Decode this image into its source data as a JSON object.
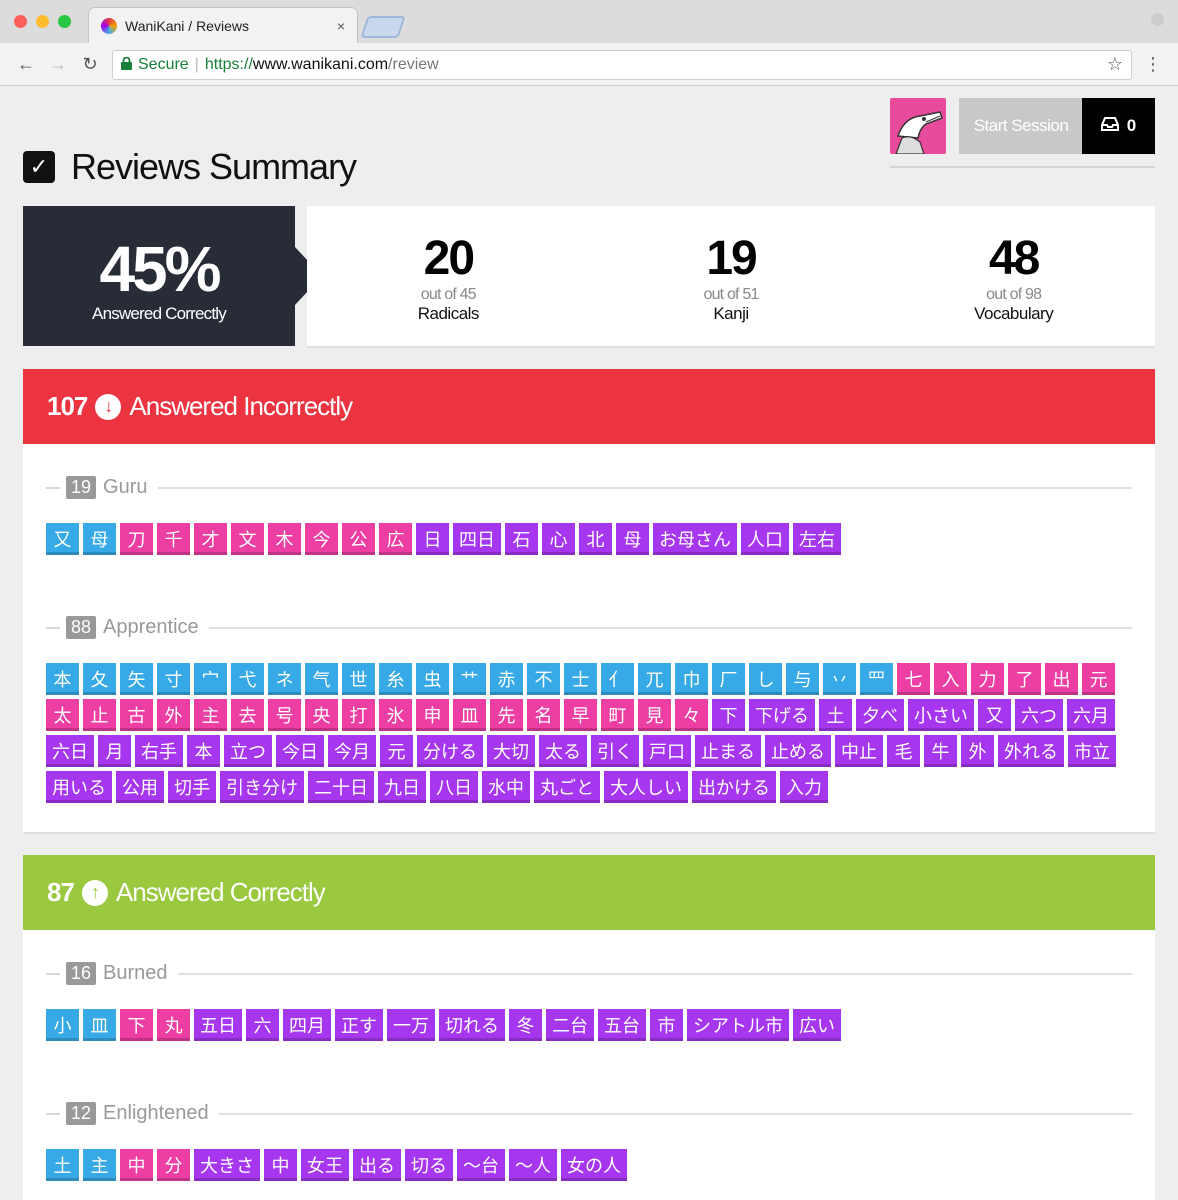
{
  "browser": {
    "tab_title": "WaniKani / Reviews",
    "tab_close": "×",
    "secure_label": "Secure",
    "url_proto": "https://",
    "url_host": "www.wanikani.com",
    "url_path": "/review"
  },
  "header": {
    "start_session_label": "Start Session",
    "inbox_count": "0"
  },
  "summary": {
    "title": "Reviews Summary",
    "percent": "45%",
    "percent_label": "Answered Correctly",
    "stats": [
      {
        "value": "20",
        "outof": "out of 45",
        "label": "Radicals"
      },
      {
        "value": "19",
        "outof": "out of 51",
        "label": "Kanji"
      },
      {
        "value": "48",
        "outof": "out of 98",
        "label": "Vocabulary"
      }
    ]
  },
  "incorrect": {
    "count": "107",
    "label": "Answered Incorrectly",
    "color": "#ec3340",
    "groups": [
      {
        "count": "19",
        "name": "Guru",
        "items": [
          {
            "text": "又",
            "type": "radical"
          },
          {
            "text": "母",
            "type": "radical"
          },
          {
            "text": "刀",
            "type": "kanji"
          },
          {
            "text": "千",
            "type": "kanji"
          },
          {
            "text": "才",
            "type": "kanji"
          },
          {
            "text": "文",
            "type": "kanji"
          },
          {
            "text": "木",
            "type": "kanji"
          },
          {
            "text": "今",
            "type": "kanji"
          },
          {
            "text": "公",
            "type": "kanji"
          },
          {
            "text": "広",
            "type": "kanji"
          },
          {
            "text": "日",
            "type": "vocabulary"
          },
          {
            "text": "四日",
            "type": "vocabulary"
          },
          {
            "text": "石",
            "type": "vocabulary"
          },
          {
            "text": "心",
            "type": "vocabulary"
          },
          {
            "text": "北",
            "type": "vocabulary"
          },
          {
            "text": "母",
            "type": "vocabulary"
          },
          {
            "text": "お母さん",
            "type": "vocabulary"
          },
          {
            "text": "人口",
            "type": "vocabulary"
          },
          {
            "text": "左右",
            "type": "vocabulary"
          }
        ]
      },
      {
        "count": "88",
        "name": "Apprentice",
        "items": [
          {
            "text": "本",
            "type": "radical"
          },
          {
            "text": "夂",
            "type": "radical"
          },
          {
            "text": "矢",
            "type": "radical"
          },
          {
            "text": "寸",
            "type": "radical"
          },
          {
            "text": "宀",
            "type": "radical"
          },
          {
            "text": "弋",
            "type": "radical"
          },
          {
            "text": "ネ",
            "type": "radical"
          },
          {
            "text": "气",
            "type": "radical"
          },
          {
            "text": "世",
            "type": "radical"
          },
          {
            "text": "糸",
            "type": "radical"
          },
          {
            "text": "虫",
            "type": "radical"
          },
          {
            "text": "艹",
            "type": "radical"
          },
          {
            "text": "赤",
            "type": "radical"
          },
          {
            "text": "不",
            "type": "radical"
          },
          {
            "text": "士",
            "type": "radical"
          },
          {
            "text": "亻",
            "type": "radical"
          },
          {
            "text": "兀",
            "type": "radical"
          },
          {
            "text": "巾",
            "type": "radical"
          },
          {
            "text": "厂",
            "type": "radical"
          },
          {
            "text": "し",
            "type": "radical"
          },
          {
            "text": "与",
            "type": "radical"
          },
          {
            "text": "丷",
            "type": "radical"
          },
          {
            "text": "罒",
            "type": "radical"
          },
          {
            "text": "七",
            "type": "kanji"
          },
          {
            "text": "入",
            "type": "kanji"
          },
          {
            "text": "力",
            "type": "kanji"
          },
          {
            "text": "了",
            "type": "kanji"
          },
          {
            "text": "出",
            "type": "kanji"
          },
          {
            "text": "元",
            "type": "kanji"
          },
          {
            "text": "太",
            "type": "kanji"
          },
          {
            "text": "止",
            "type": "kanji"
          },
          {
            "text": "古",
            "type": "kanji"
          },
          {
            "text": "外",
            "type": "kanji"
          },
          {
            "text": "主",
            "type": "kanji"
          },
          {
            "text": "去",
            "type": "kanji"
          },
          {
            "text": "号",
            "type": "kanji"
          },
          {
            "text": "央",
            "type": "kanji"
          },
          {
            "text": "打",
            "type": "kanji"
          },
          {
            "text": "氷",
            "type": "kanji"
          },
          {
            "text": "申",
            "type": "kanji"
          },
          {
            "text": "皿",
            "type": "kanji"
          },
          {
            "text": "先",
            "type": "kanji"
          },
          {
            "text": "名",
            "type": "kanji"
          },
          {
            "text": "早",
            "type": "kanji"
          },
          {
            "text": "町",
            "type": "kanji"
          },
          {
            "text": "見",
            "type": "kanji"
          },
          {
            "text": "々",
            "type": "kanji"
          },
          {
            "text": "下",
            "type": "vocabulary"
          },
          {
            "text": "下げる",
            "type": "vocabulary"
          },
          {
            "text": "土",
            "type": "vocabulary"
          },
          {
            "text": "夕べ",
            "type": "vocabulary"
          },
          {
            "text": "小さい",
            "type": "vocabulary"
          },
          {
            "text": "又",
            "type": "vocabulary"
          },
          {
            "text": "六つ",
            "type": "vocabulary"
          },
          {
            "text": "六月",
            "type": "vocabulary"
          },
          {
            "text": "六日",
            "type": "vocabulary"
          },
          {
            "text": "月",
            "type": "vocabulary"
          },
          {
            "text": "右手",
            "type": "vocabulary"
          },
          {
            "text": "本",
            "type": "vocabulary"
          },
          {
            "text": "立つ",
            "type": "vocabulary"
          },
          {
            "text": "今日",
            "type": "vocabulary"
          },
          {
            "text": "今月",
            "type": "vocabulary"
          },
          {
            "text": "元",
            "type": "vocabulary"
          },
          {
            "text": "分ける",
            "type": "vocabulary"
          },
          {
            "text": "大切",
            "type": "vocabulary"
          },
          {
            "text": "太る",
            "type": "vocabulary"
          },
          {
            "text": "引く",
            "type": "vocabulary"
          },
          {
            "text": "戸口",
            "type": "vocabulary"
          },
          {
            "text": "止まる",
            "type": "vocabulary"
          },
          {
            "text": "止める",
            "type": "vocabulary"
          },
          {
            "text": "中止",
            "type": "vocabulary"
          },
          {
            "text": "毛",
            "type": "vocabulary"
          },
          {
            "text": "牛",
            "type": "vocabulary"
          },
          {
            "text": "外",
            "type": "vocabulary"
          },
          {
            "text": "外れる",
            "type": "vocabulary"
          },
          {
            "text": "市立",
            "type": "vocabulary"
          },
          {
            "text": "用いる",
            "type": "vocabulary"
          },
          {
            "text": "公用",
            "type": "vocabulary"
          },
          {
            "text": "切手",
            "type": "vocabulary"
          },
          {
            "text": "引き分け",
            "type": "vocabulary"
          },
          {
            "text": "二十日",
            "type": "vocabulary"
          },
          {
            "text": "九日",
            "type": "vocabulary"
          },
          {
            "text": "八日",
            "type": "vocabulary"
          },
          {
            "text": "水中",
            "type": "vocabulary"
          },
          {
            "text": "丸ごと",
            "type": "vocabulary"
          },
          {
            "text": "大人しい",
            "type": "vocabulary"
          },
          {
            "text": "出かける",
            "type": "vocabulary"
          },
          {
            "text": "入力",
            "type": "vocabulary"
          }
        ]
      }
    ]
  },
  "correct": {
    "count": "87",
    "label": "Answered Correctly",
    "color": "#9ac83e",
    "groups": [
      {
        "count": "16",
        "name": "Burned",
        "items": [
          {
            "text": "小",
            "type": "radical"
          },
          {
            "text": "皿",
            "type": "radical"
          },
          {
            "text": "下",
            "type": "kanji"
          },
          {
            "text": "丸",
            "type": "kanji"
          },
          {
            "text": "五日",
            "type": "vocabulary"
          },
          {
            "text": "六",
            "type": "vocabulary"
          },
          {
            "text": "四月",
            "type": "vocabulary"
          },
          {
            "text": "正す",
            "type": "vocabulary"
          },
          {
            "text": "一万",
            "type": "vocabulary"
          },
          {
            "text": "切れる",
            "type": "vocabulary"
          },
          {
            "text": "冬",
            "type": "vocabulary"
          },
          {
            "text": "二台",
            "type": "vocabulary"
          },
          {
            "text": "五台",
            "type": "vocabulary"
          },
          {
            "text": "市",
            "type": "vocabulary"
          },
          {
            "text": "シアトル市",
            "type": "vocabulary"
          },
          {
            "text": "広い",
            "type": "vocabulary"
          }
        ]
      },
      {
        "count": "12",
        "name": "Enlightened",
        "items": [
          {
            "text": "土",
            "type": "radical"
          },
          {
            "text": "主",
            "type": "radical"
          },
          {
            "text": "中",
            "type": "kanji"
          },
          {
            "text": "分",
            "type": "kanji"
          },
          {
            "text": "大きさ",
            "type": "vocabulary"
          },
          {
            "text": "中",
            "type": "vocabulary"
          },
          {
            "text": "女王",
            "type": "vocabulary"
          },
          {
            "text": "出る",
            "type": "vocabulary"
          },
          {
            "text": "切る",
            "type": "vocabulary"
          },
          {
            "text": "〜台",
            "type": "vocabulary"
          },
          {
            "text": "〜人",
            "type": "vocabulary"
          },
          {
            "text": "女の人",
            "type": "vocabulary"
          }
        ]
      }
    ]
  },
  "colors": {
    "radical": "#36a9e6",
    "kanji": "#ec3ea3",
    "vocabulary": "#a637ef",
    "score_panel": "#272c37"
  }
}
